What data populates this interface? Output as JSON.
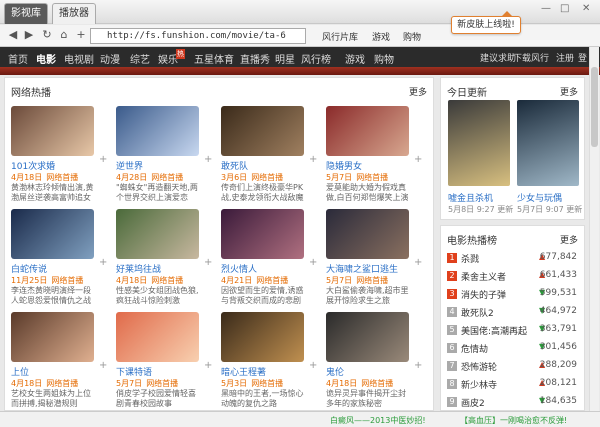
{
  "tabs": [
    "影视库",
    "播放器"
  ],
  "tooltip": "新皮肤上线啦!",
  "window_controls": [
    "—",
    "□",
    "✕"
  ],
  "toolbar": {
    "url": "http://fs.funshion.com/movie/ta-6",
    "links": [
      "风行片库",
      "游戏",
      "购物"
    ]
  },
  "nav": {
    "items": [
      "首页",
      "电影",
      "电视剧",
      "动漫",
      "综艺",
      "娱乐",
      "五星体育",
      "直播秀",
      "明星",
      "风行榜",
      "游戏",
      "购物"
    ],
    "hot_badge": "热",
    "right": [
      "建议求助",
      "下载风行",
      "注册",
      "登"
    ],
    "active": "电影"
  },
  "main": {
    "title": "网络热播",
    "more": "更多",
    "cards": [
      {
        "title": "101次求婚",
        "date": "4月18日",
        "status": "网络首播",
        "desc": "黄渤林志玲倾情出演,黄渤屌丝逆袭高富帅追女神",
        "colors": [
          "#6b4a3a",
          "#e8c8a8"
        ]
      },
      {
        "title": "逆世界",
        "date": "4月28日",
        "status": "网络首播",
        "desc": "\"蜘蛛女\"再造翻天地,两个世界交织上演爱恋",
        "colors": [
          "#3a5a8a",
          "#c8d8f0"
        ]
      },
      {
        "title": "敢死队",
        "date": "3月6日",
        "status": "网络首播",
        "desc": "传奇们上演终极豪华PK战,史泰龙领衔大战敌魔",
        "colors": [
          "#3a2a1a",
          "#a08060"
        ]
      },
      {
        "title": "隐婚男女",
        "date": "5月7日",
        "status": "网络首播",
        "desc": "爱莫能助大婚为假戏真做,白百何郑恺爆笑上演",
        "colors": [
          "#8a2a2a",
          "#d8a890"
        ]
      },
      {
        "title": "白蛇传说",
        "date": "11月25日",
        "status": "网络首播",
        "desc": "李连杰黄晓明演绎一段人蛇恩怨爱恨情仇之战",
        "colors": [
          "#1a2a4a",
          "#80a0c0"
        ]
      },
      {
        "title": "好莱坞往战",
        "date": "4月18日",
        "status": "网络首播",
        "desc": "性感美少女组团战色狼,疯狂战斗惊险刺激",
        "colors": [
          "#4a6a3a",
          "#c8b8a0"
        ]
      },
      {
        "title": "烈火情人",
        "date": "4月21日",
        "status": "网络首播",
        "desc": "因欲望而生的爱情,诱惑与背叛交织而成的悲剧",
        "colors": [
          "#3a1a3a",
          "#b07080"
        ]
      },
      {
        "title": "大海啸之鲨口逃生",
        "date": "5月7日",
        "status": "网络首播",
        "desc": "大白鲨偷袭海啸,超市里展开惊险求生之旅",
        "colors": [
          "#2a2a3a",
          "#8a7060"
        ]
      },
      {
        "title": "上位",
        "date": "4月18日",
        "status": "网络首播",
        "desc": "艺校女生两姐妹为上位而拼搏,揭秘潜规则",
        "colors": [
          "#5a3a2a",
          "#e0b090"
        ]
      },
      {
        "title": "下课特语",
        "date": "5月7日",
        "status": "网络首播",
        "desc": "俏皮学子校园爱情轻喜剧青春校园故事",
        "colors": [
          "#e06a4a",
          "#f8d0b0"
        ]
      },
      {
        "title": "暗心王程著",
        "date": "5月3日",
        "status": "网络首播",
        "desc": "黑暗中的王者,一场惊心动魄的复仇之路",
        "colors": [
          "#3a2a1a",
          "#c09050"
        ]
      },
      {
        "title": "鬼伦",
        "date": "4月18日",
        "status": "网络首播",
        "desc": "诡异灵异事件揭开尘封多年的家族秘密",
        "colors": [
          "#2a2a2a",
          "#9a8a7a"
        ]
      }
    ]
  },
  "today": {
    "title": "今日更新",
    "more": "更多",
    "items": [
      {
        "title": "嘘金且杀机",
        "date": "5月8日 9:27 更新",
        "colors": [
          "#3a3a3a",
          "#d8c080"
        ]
      },
      {
        "title": "少女与玩偶",
        "date": "5月7日 9:07 更新",
        "colors": [
          "#1a2a3a",
          "#a0b8c8"
        ]
      }
    ]
  },
  "ranking": {
    "title": "电影热播榜",
    "more": "更多",
    "items": [
      {
        "name": "杀戮",
        "trend": "up",
        "value": "677,842"
      },
      {
        "name": "柔舍主义者",
        "trend": "up",
        "value": "661,433"
      },
      {
        "name": "消失的子弹",
        "trend": "down",
        "value": "599,531"
      },
      {
        "name": "敢死队2",
        "trend": "down",
        "value": "464,972"
      },
      {
        "name": "美国佬:高潮再起",
        "trend": "down",
        "value": "363,791"
      },
      {
        "name": "危情劫",
        "trend": "down",
        "value": "301,456"
      },
      {
        "name": "恐怖游轮",
        "trend": "up",
        "value": "288,209"
      },
      {
        "name": "新少林寺",
        "trend": "up",
        "value": "208,121"
      },
      {
        "name": "画皮2",
        "trend": "down",
        "value": "184,635"
      }
    ]
  },
  "statusbar": {
    "left": "白癜风——2013中医妙招!",
    "right": "【高血压】一刚喝治愈不反弹!"
  }
}
